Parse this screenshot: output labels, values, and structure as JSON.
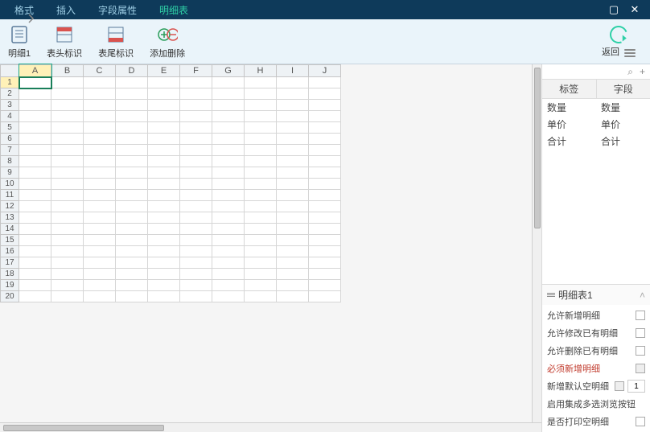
{
  "menu": {
    "items": [
      "格式",
      "插入",
      "字段属性",
      "明细表"
    ],
    "active_index": 3
  },
  "window_controls": {
    "max": "▢",
    "close": "✕"
  },
  "toolbar": {
    "groups": [
      {
        "name": "detail1",
        "label": "明细1",
        "icon": "form-icon"
      },
      {
        "name": "head-marker",
        "label": "表头标识",
        "icon": "header-icon"
      },
      {
        "name": "tail-marker",
        "label": "表尾标识",
        "icon": "footer-icon"
      },
      {
        "name": "add-delete",
        "label": "添加删除",
        "icon": "plus-minus-icon"
      }
    ],
    "back_label": "返回"
  },
  "grid": {
    "columns": [
      "A",
      "B",
      "C",
      "D",
      "E",
      "F",
      "G",
      "H",
      "I",
      "J"
    ],
    "row_count": 20,
    "selected": {
      "row": 1,
      "col": 0
    }
  },
  "right_panel": {
    "headers": [
      "标签",
      "字段"
    ],
    "rows": [
      {
        "label": "数量",
        "field": "数量"
      },
      {
        "label": "单价",
        "field": "单价"
      },
      {
        "label": "合计",
        "field": "合计"
      }
    ],
    "section_title": "明细表1",
    "props": [
      {
        "key": "allow-add",
        "label": "允许新增明细",
        "type": "check",
        "checked": false
      },
      {
        "key": "allow-edit",
        "label": "允许修改已有明细",
        "type": "check",
        "checked": false
      },
      {
        "key": "allow-del",
        "label": "允许删除已有明细",
        "type": "check",
        "checked": false
      },
      {
        "key": "must-add",
        "label": "必须新增明细",
        "type": "check",
        "checked": false,
        "required": true,
        "disabled": true
      },
      {
        "key": "default-blank",
        "label": "新增默认空明细",
        "type": "input",
        "value": "1"
      },
      {
        "key": "multi-browse",
        "label": "启用集成多选浏览按钮",
        "type": "none"
      },
      {
        "key": "print-blank",
        "label": "是否打印空明细",
        "type": "check",
        "checked": false
      }
    ],
    "icons": {
      "search": "⌕",
      "add": "+"
    }
  }
}
